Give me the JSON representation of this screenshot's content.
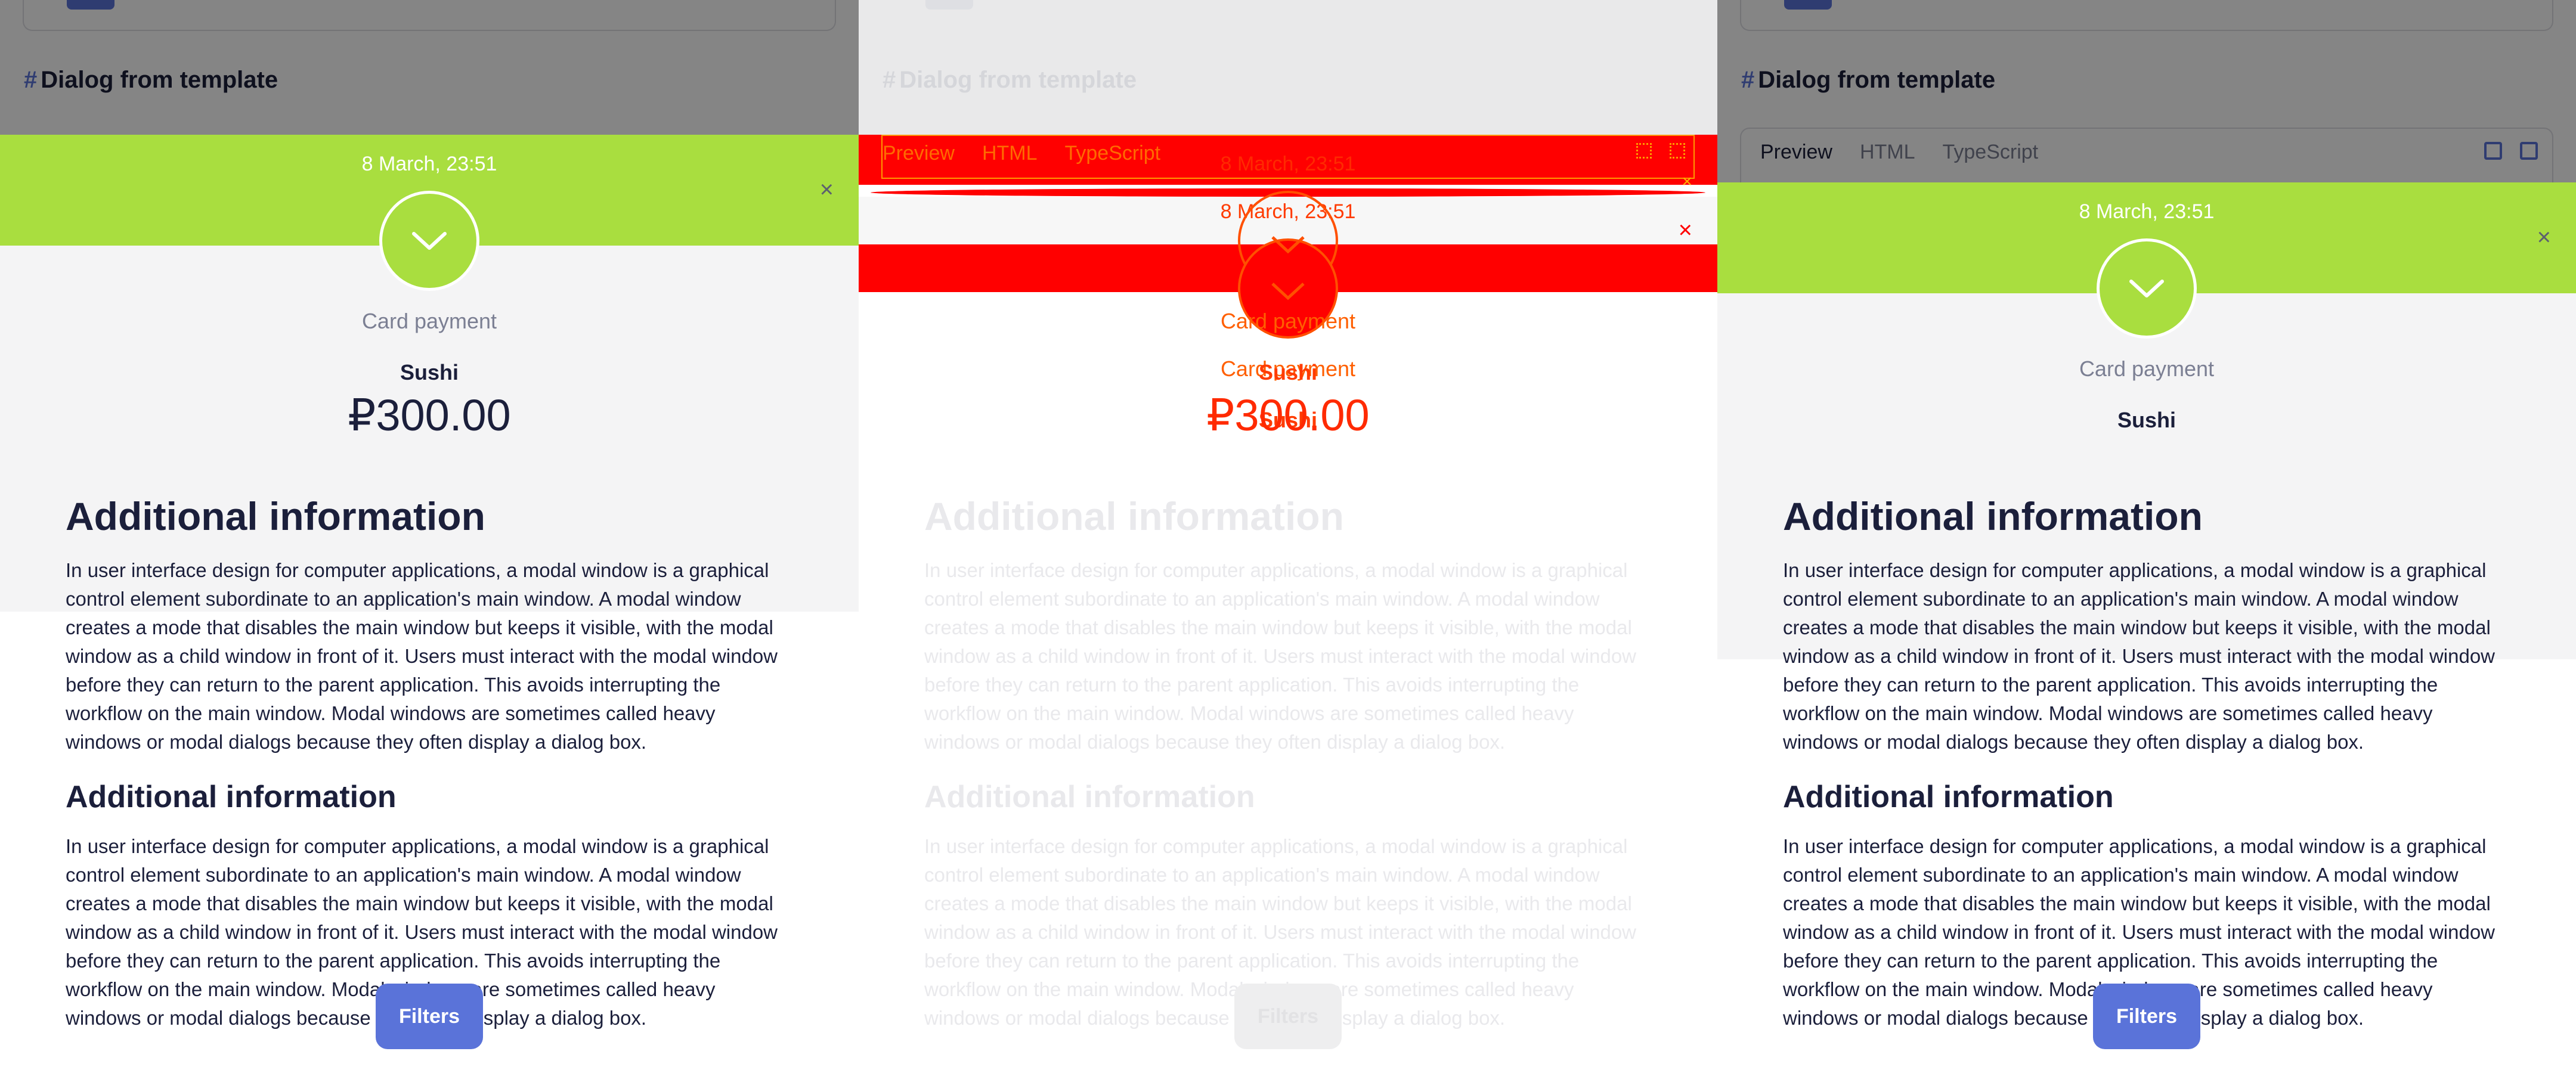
{
  "doc": {
    "heading_hash": "#",
    "heading": "Dialog from template",
    "tabs": [
      "Preview",
      "HTML",
      "TypeScript"
    ],
    "active_tab": "Preview"
  },
  "dialog": {
    "date": "8 March, 23:51",
    "close": "×",
    "method": "Card payment",
    "title": "Sushi",
    "amount": "₽300.00",
    "accent_color": "#a9de3f"
  },
  "article": {
    "h1": "Additional information",
    "p1": "In user interface design for computer applications, a modal window is a graphical control element subordinate to an application's main window. A modal window creates a mode that disables the main window but keeps it visible, with the modal window as a child window in front of it. Users must interact with the modal window before they can return to the parent application. This avoids interrupting the workflow on the main window. Modal windows are sometimes called heavy windows or modal dialogs because they often display a dialog box.",
    "h2": "Additional information",
    "p2": "In user interface design for computer applications, a modal window is a graphical control element subordinate to an application's main window. A modal window creates a mode that disables the main window but keeps it visible, with the modal window as a child window in front of it. Users must interact with the modal window before they can return to the parent application. This avoids interrupting the workflow on the main window. Modal windows are sometimes called heavy windows or modal dialogs because they often display a dialog box."
  },
  "filters_label": "Filters",
  "colors": {
    "primary": "#5a73d9",
    "diff_red": "#ff0000",
    "diff_orange": "#ff5f00"
  }
}
